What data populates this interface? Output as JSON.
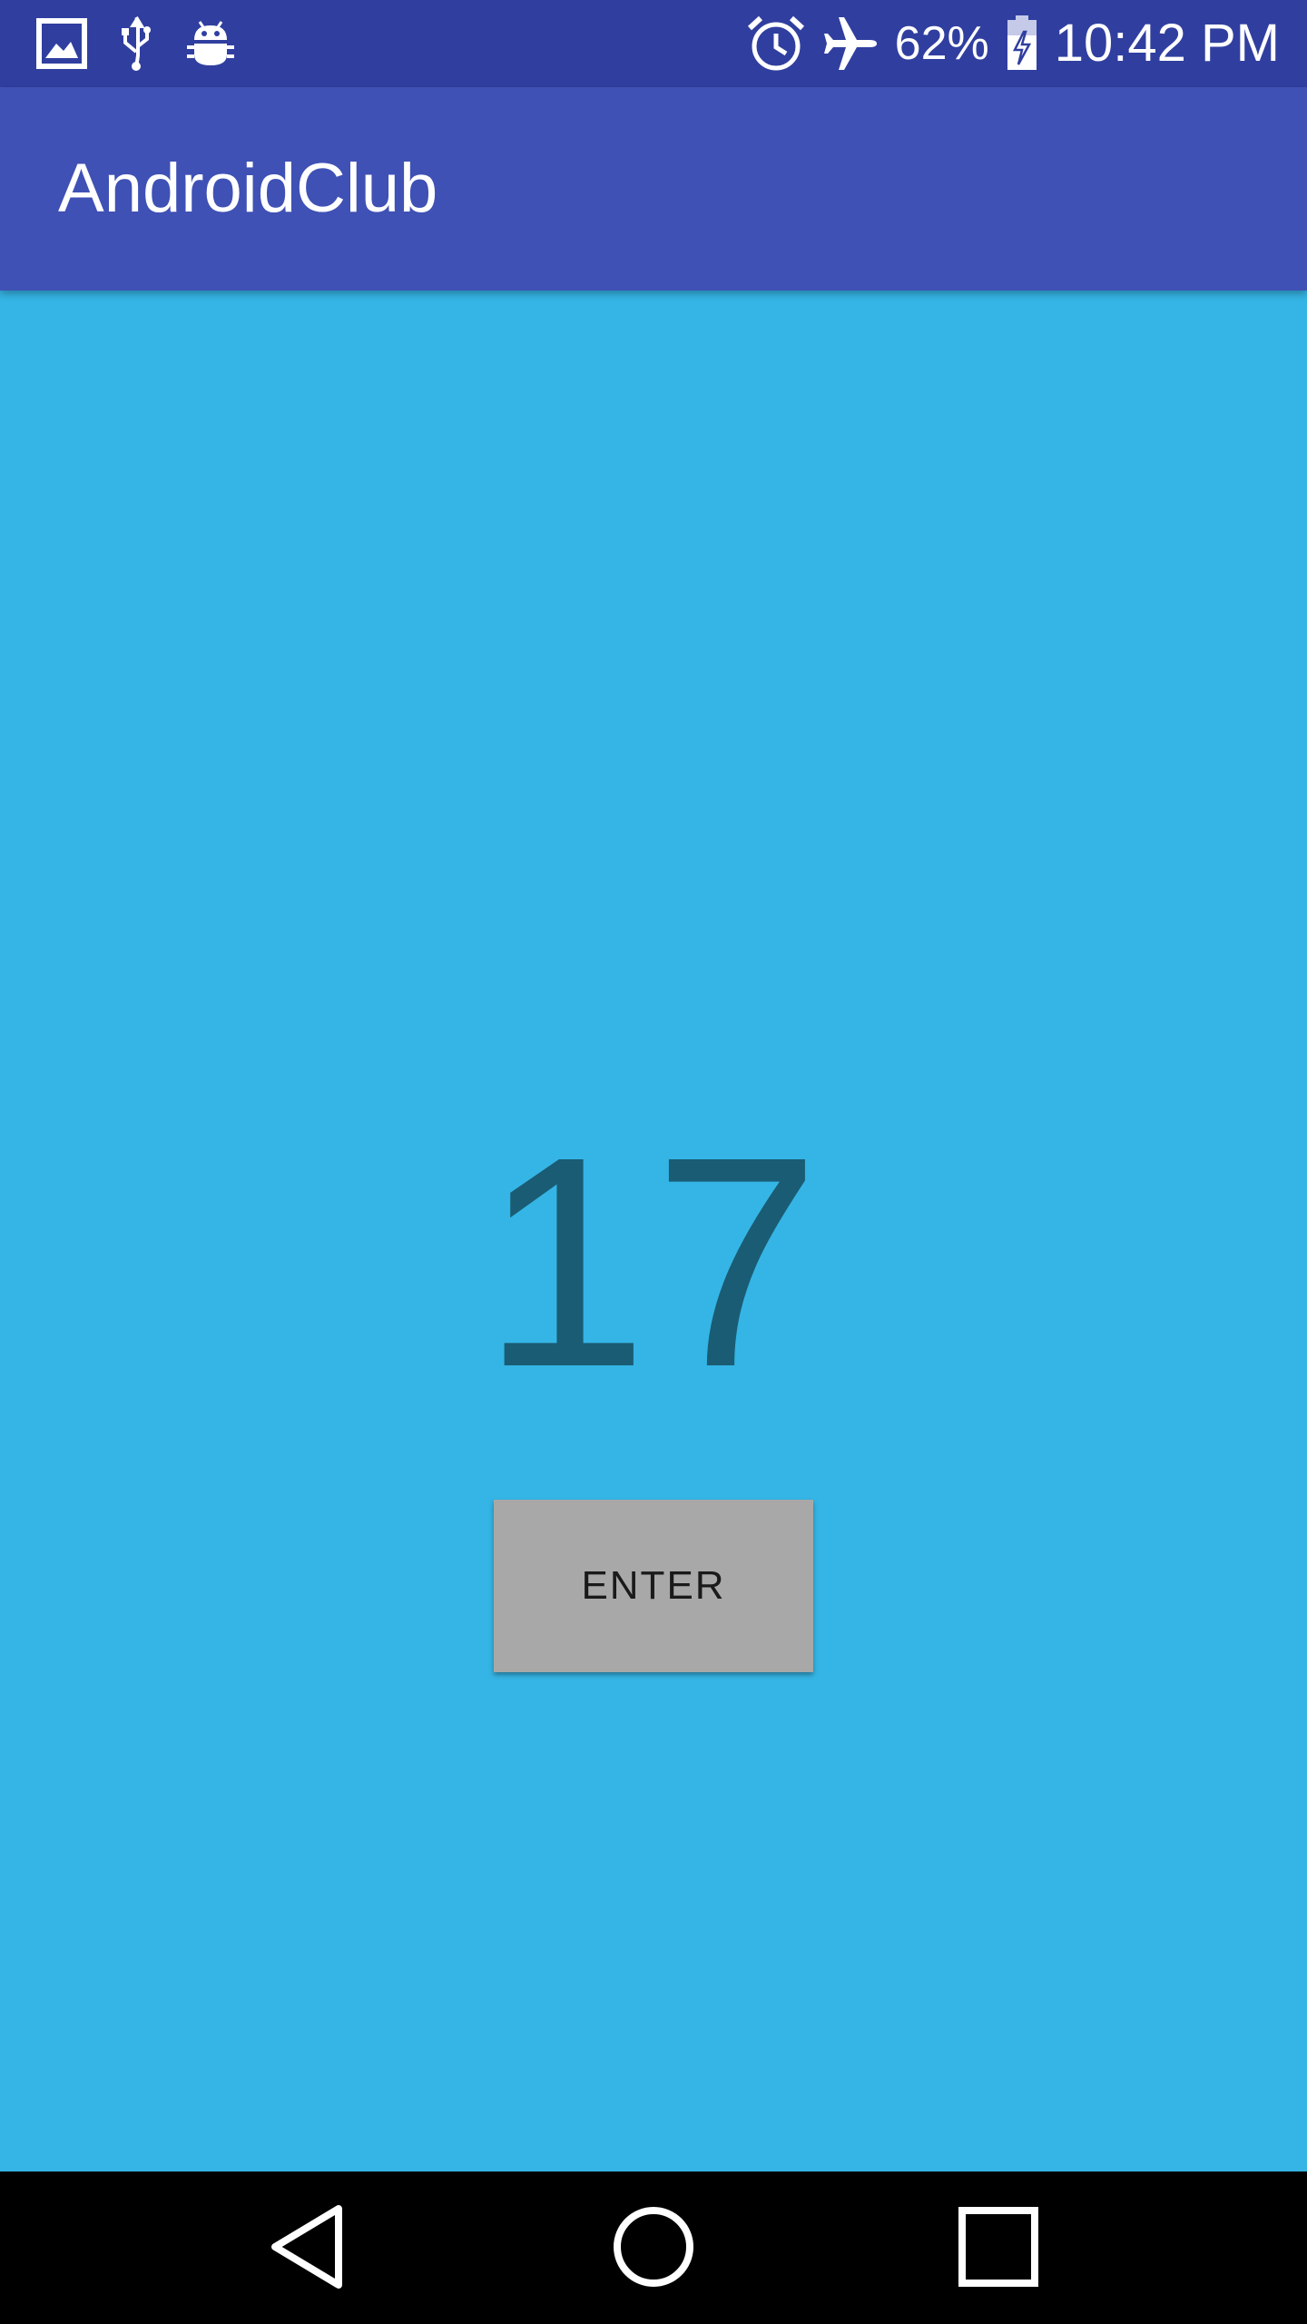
{
  "status_bar": {
    "icons_left": [
      "image-icon",
      "usb-icon",
      "android-debug-icon"
    ],
    "icons_right": [
      "alarm-icon",
      "airplane-mode-icon",
      "battery-charging-icon"
    ],
    "battery_percent": "62%",
    "time": "10:42 PM"
  },
  "app_bar": {
    "title": "AndroidClub"
  },
  "main": {
    "counter_value": "17",
    "enter_label": "ENTER"
  },
  "nav_bar": {
    "icons": [
      "back-icon",
      "home-icon",
      "recents-icon"
    ]
  },
  "colors": {
    "status_bar": "#303f9f",
    "app_bar": "#3f51b5",
    "background": "#35b5e5",
    "counter_text": "#1a5c74",
    "button": "#a8a8a8",
    "nav_bar": "#000000"
  }
}
